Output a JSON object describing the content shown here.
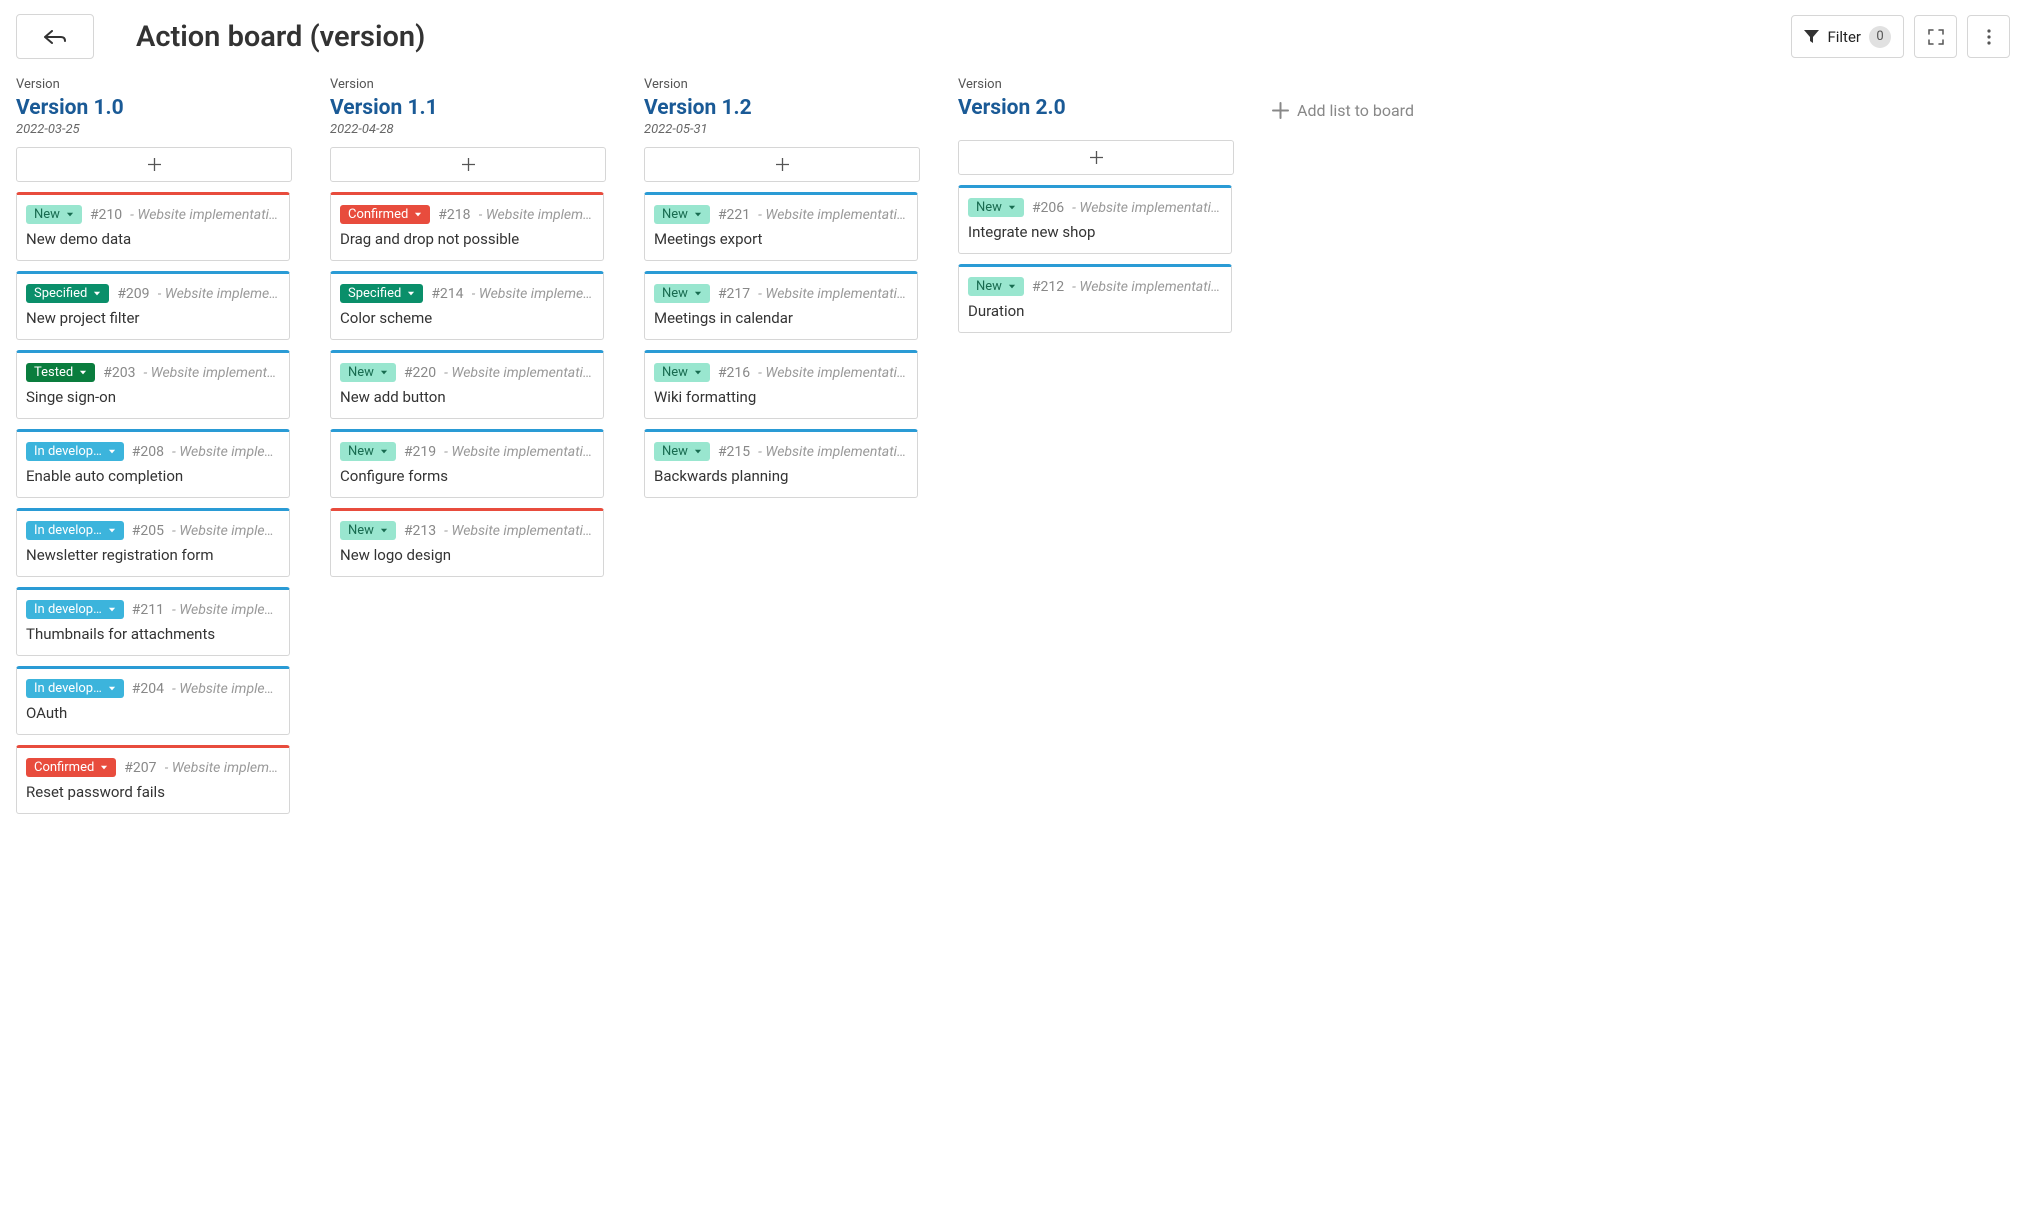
{
  "header": {
    "page_title": "Action board (version)",
    "filter_label": "Filter",
    "filter_count": "0",
    "add_list_label": "Add list to board"
  },
  "col_label": "Version",
  "columns": [
    {
      "title": "Version 1.0",
      "date": "2022-03-25",
      "cards": [
        {
          "color": "red",
          "status": "New",
          "status_class": "new",
          "id": "#210",
          "project": "Website implementation",
          "title": "New demo data"
        },
        {
          "color": "blue",
          "status": "Specified",
          "status_class": "specified",
          "id": "#209",
          "project": "Website implement…",
          "title": "New project filter"
        },
        {
          "color": "blue",
          "status": "Tested",
          "status_class": "tested",
          "id": "#203",
          "project": "Website implementation",
          "title": "Singe sign-on"
        },
        {
          "color": "blue",
          "status": "In develop…",
          "status_class": "indev",
          "id": "#208",
          "project": "Website implem…",
          "title": "Enable auto completion"
        },
        {
          "color": "blue",
          "status": "In develop…",
          "status_class": "indev",
          "id": "#205",
          "project": "Website implem…",
          "title": "Newsletter registration form"
        },
        {
          "color": "blue",
          "status": "In develop…",
          "status_class": "indev",
          "id": "#211",
          "project": "Website implem…",
          "title": "Thumbnails for attachments"
        },
        {
          "color": "blue",
          "status": "In develop…",
          "status_class": "indev",
          "id": "#204",
          "project": "Website implem…",
          "title": "OAuth"
        },
        {
          "color": "red",
          "status": "Confirmed",
          "status_class": "confirmed",
          "id": "#207",
          "project": "Website implemen…",
          "title": "Reset password fails"
        }
      ]
    },
    {
      "title": "Version 1.1",
      "date": "2022-04-28",
      "cards": [
        {
          "color": "red",
          "status": "Confirmed",
          "status_class": "confirmed",
          "id": "#218",
          "project": "Website implemen…",
          "title": "Drag and drop not possible"
        },
        {
          "color": "blue",
          "status": "Specified",
          "status_class": "specified",
          "id": "#214",
          "project": "Website implement…",
          "title": "Color scheme"
        },
        {
          "color": "blue",
          "status": "New",
          "status_class": "new",
          "id": "#220",
          "project": "Website implementation",
          "title": "New add button"
        },
        {
          "color": "blue",
          "status": "New",
          "status_class": "new",
          "id": "#219",
          "project": "Website implementation",
          "title": "Configure forms"
        },
        {
          "color": "red",
          "status": "New",
          "status_class": "new",
          "id": "#213",
          "project": "Website implementation",
          "title": "New logo design"
        }
      ]
    },
    {
      "title": "Version 1.2",
      "date": "2022-05-31",
      "cards": [
        {
          "color": "blue",
          "status": "New",
          "status_class": "new",
          "id": "#221",
          "project": "Website implementation",
          "title": "Meetings export"
        },
        {
          "color": "blue",
          "status": "New",
          "status_class": "new",
          "id": "#217",
          "project": "Website implementation",
          "title": "Meetings in calendar"
        },
        {
          "color": "blue",
          "status": "New",
          "status_class": "new",
          "id": "#216",
          "project": "Website implementation",
          "title": "Wiki formatting"
        },
        {
          "color": "blue",
          "status": "New",
          "status_class": "new",
          "id": "#215",
          "project": "Website implementation",
          "title": "Backwards planning"
        }
      ]
    },
    {
      "title": "Version 2.0",
      "date": "",
      "cards": [
        {
          "color": "blue",
          "status": "New",
          "status_class": "new",
          "id": "#206",
          "project": "Website implementation",
          "title": "Integrate new shop"
        },
        {
          "color": "blue",
          "status": "New",
          "status_class": "new",
          "id": "#212",
          "project": "Website implementation",
          "title": "Duration"
        }
      ]
    }
  ]
}
